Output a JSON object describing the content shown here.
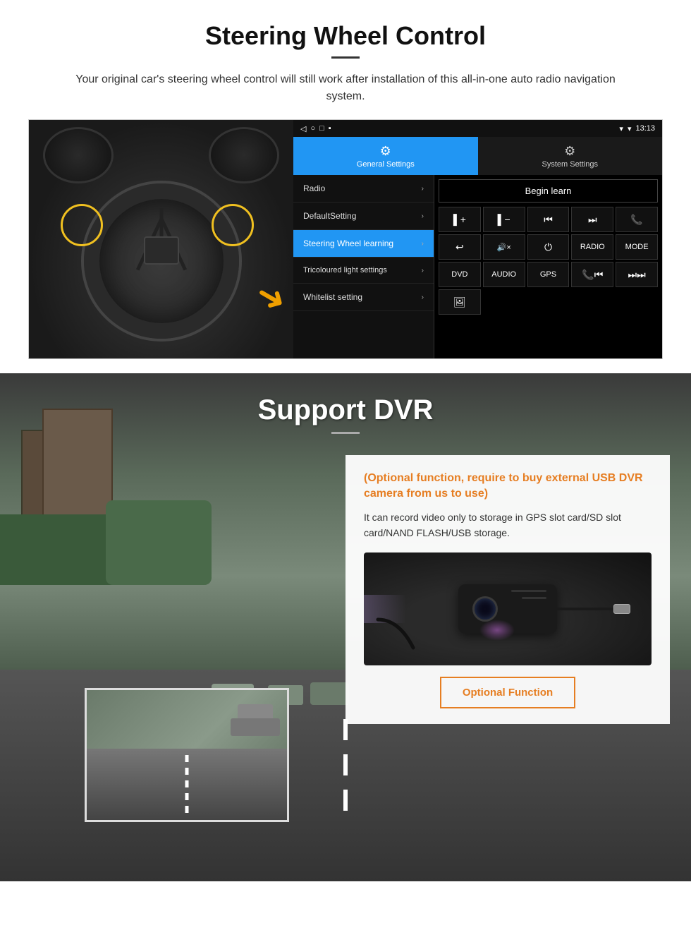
{
  "steering": {
    "title": "Steering Wheel Control",
    "description": "Your original car's steering wheel control will still work after installation of this all-in-one auto radio navigation system.",
    "status_bar": {
      "time": "13:13",
      "icons": "▾ ◉"
    },
    "tabs": [
      {
        "id": "general",
        "label": "General Settings",
        "icon": "⚙",
        "active": true
      },
      {
        "id": "system",
        "label": "System Settings",
        "icon": "⚙",
        "active": false
      }
    ],
    "menu_items": [
      {
        "label": "Radio",
        "active": false
      },
      {
        "label": "DefaultSetting",
        "active": false
      },
      {
        "label": "Steering Wheel learning",
        "active": true
      },
      {
        "label": "Tricoloured light settings",
        "active": false
      },
      {
        "label": "Whitelist setting",
        "active": false
      }
    ],
    "begin_learn_label": "Begin learn",
    "control_buttons": [
      "▌+",
      "▌−",
      "⏮",
      "⏭",
      "📞",
      "↩",
      "🔊×",
      "⏻",
      "RADIO",
      "MODE",
      "DVD",
      "AUDIO",
      "GPS",
      "📞⏮",
      "⏭"
    ]
  },
  "dvr": {
    "title": "Support DVR",
    "optional_title": "(Optional function, require to buy external USB DVR camera from us to use)",
    "description": "It can record video only to storage in GPS slot card/SD slot card/NAND FLASH/USB storage.",
    "optional_function_label": "Optional Function"
  }
}
